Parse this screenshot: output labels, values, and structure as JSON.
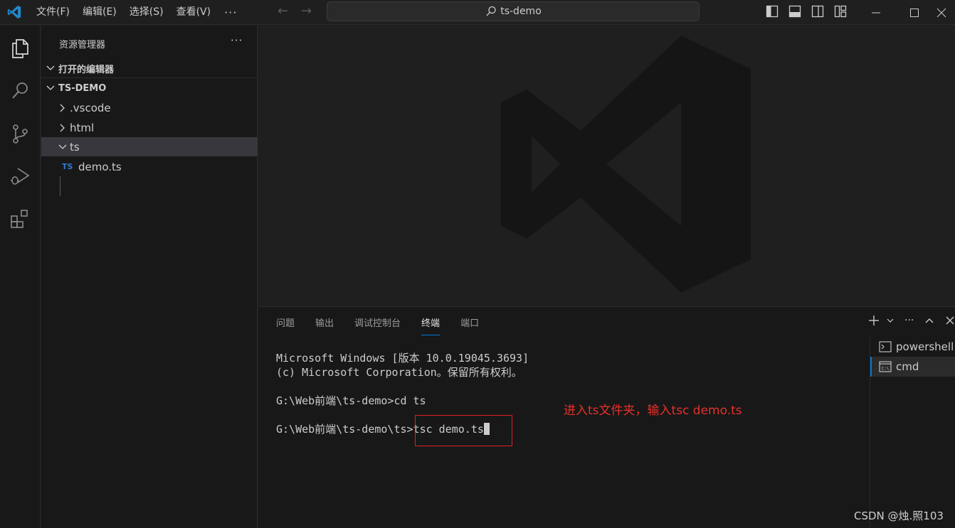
{
  "titlebar": {
    "menu": [
      "文件(F)",
      "编辑(E)",
      "选择(S)",
      "查看(V)"
    ],
    "more": "···",
    "search_text": "ts-demo"
  },
  "sidebar": {
    "title": "资源管理器",
    "more": "···",
    "open_editors": "打开的编辑器",
    "project": "TS-DEMO",
    "items": [
      {
        "label": ".vscode",
        "type": "folder",
        "expanded": false
      },
      {
        "label": "html",
        "type": "folder",
        "expanded": false
      },
      {
        "label": "ts",
        "type": "folder",
        "expanded": true
      },
      {
        "label": "demo.ts",
        "type": "file",
        "badge": "TS"
      }
    ]
  },
  "panel": {
    "tabs": [
      "问题",
      "输出",
      "调试控制台",
      "终端",
      "端口"
    ],
    "active_tab": "终端",
    "terminal_lines": [
      "Microsoft Windows [版本 10.0.19045.3693]",
      "(c) Microsoft Corporation。保留所有权利。",
      "",
      "G:\\Web前端\\ts-demo>cd ts",
      "",
      "G:\\Web前端\\ts-demo\\ts>tsc demo.ts"
    ],
    "annotation": "进入ts文件夹，输入tsc demo.ts",
    "terminal_list": [
      "powershell",
      "cmd"
    ]
  },
  "watermark_text": "CSDN @烛.照103",
  "colors": {
    "accent": "#0078d4",
    "annotation_red": "#e02020",
    "ts_blue": "#3178c6",
    "vscode_blue": "#2489ca"
  }
}
